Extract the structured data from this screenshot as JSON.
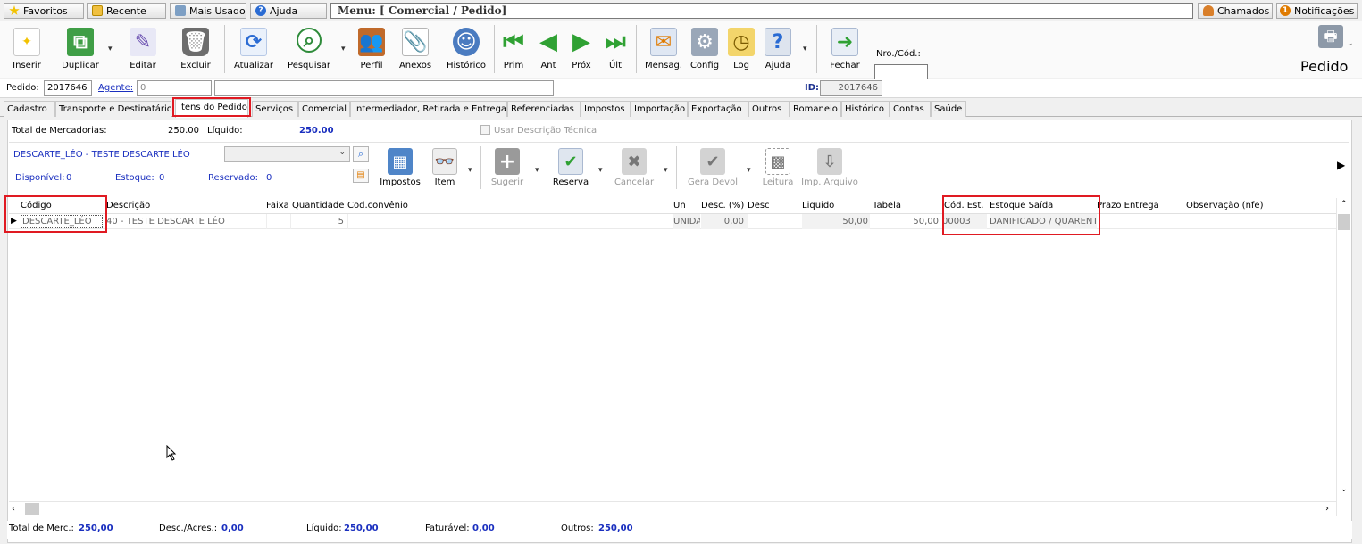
{
  "topbar": {
    "favoritos": "Favoritos",
    "recente": "Recente",
    "mais_usados": "Mais Usados",
    "ajuda": "Ajuda",
    "menu_path": "Menu: [ Comercial / Pedido]",
    "chamados": "Chamados",
    "notificacoes": "Notificações",
    "notif_count": "1"
  },
  "toolbar": {
    "buttons": [
      {
        "label": "Inserir",
        "icon": "new-document-icon"
      },
      {
        "label": "Duplicar",
        "icon": "duplicate-icon"
      },
      {
        "label": "Editar",
        "icon": "edit-pencil-icon"
      },
      {
        "label": "Excluir",
        "icon": "trash-icon"
      },
      {
        "label": "Atualizar",
        "icon": "refresh-icon"
      },
      {
        "label": "Pesquisar",
        "icon": "search-icon"
      },
      {
        "label": "Perfil",
        "icon": "users-icon"
      },
      {
        "label": "Anexos",
        "icon": "attachment-icon"
      },
      {
        "label": "Histórico",
        "icon": "history-icon"
      },
      {
        "label": "Prim",
        "icon": "first-arrow-icon"
      },
      {
        "label": "Ant",
        "icon": "prev-arrow-icon"
      },
      {
        "label": "Próx",
        "icon": "next-arrow-icon"
      },
      {
        "label": "Últ",
        "icon": "last-arrow-icon"
      },
      {
        "label": "Mensag.",
        "icon": "messages-icon"
      },
      {
        "label": "Config",
        "icon": "config-icon"
      },
      {
        "label": "Log",
        "icon": "log-icon"
      },
      {
        "label": "Ajuda",
        "icon": "help-doc-icon"
      },
      {
        "label": "Fechar",
        "icon": "exit-door-icon"
      }
    ],
    "nro_label": "Nro./Cód.:",
    "nro_value": "",
    "module_title": "Pedido"
  },
  "pedido_line": {
    "pedido_label": "Pedido:",
    "pedido_value": "2017646",
    "agente_label": "Agente:",
    "agente_value": "0",
    "id_label": "ID:",
    "id_value": "2017646"
  },
  "tabs": [
    "Cadastro",
    "Transporte e Destinatário",
    "Itens do Pedido",
    "Serviços",
    "Comercial",
    "Intermediador, Retirada e Entrega",
    "Referenciadas",
    "Impostos",
    "Importação",
    "Exportação",
    "Outros",
    "Romaneio",
    "Histórico",
    "Contas",
    "Saúde"
  ],
  "active_tab": "Itens do Pedido",
  "itens": {
    "total_merc_label": "Total de Mercadorias:",
    "total_merc_value": "250.00",
    "liquido_label": "Líquido:",
    "liquido_value": "250.00",
    "usar_desc_label": "Usar Descrição Técnica",
    "product_name": "DESCARTE_LÉO - TESTE DESCARTE LÉO",
    "disponivel_label": "Disponível:",
    "disponivel_value": "0",
    "estoque_label": "Estoque:",
    "estoque_value": "0",
    "reservado_label": "Reservado:",
    "reservado_value": "0",
    "tools": {
      "impostos": "Impostos",
      "item": "Item",
      "sugerir": "Sugerir",
      "reserva": "Reserva",
      "cancelar": "Cancelar",
      "gera_devol": "Gera Devol",
      "leitura": "Leitura",
      "imp_arquivo": "Imp. Arquivo"
    }
  },
  "grid": {
    "headers": {
      "codigo": "Código",
      "descricao": "Descrição",
      "faixa": "Faixa",
      "quantidade": "Quantidade",
      "cod_convenio": "Cod.convênio",
      "un": "Un",
      "desc_pct": "Desc. (%)",
      "desc": "Desc",
      "liquido": "Liquido",
      "tabela": "Tabela",
      "cod_est": "Cód. Est.",
      "estoque_saida": "Estoque Saída",
      "prazo_entrega": "Prazo Entrega",
      "observacao": "Observação (nfe)"
    },
    "rows": [
      {
        "codigo": "DESCARTE_LÉO",
        "descricao": "40 - TESTE DESCARTE LÉO",
        "faixa": "",
        "quantidade": "5",
        "cod_convenio": "",
        "un": "UNIDA",
        "desc_pct": "0,00",
        "desc": "",
        "liquido": "50,00",
        "tabela": "50,00",
        "cod_est": "00003",
        "estoque_saida": "DANIFICADO / QUARENT",
        "prazo_entrega": "",
        "observacao": ""
      }
    ]
  },
  "footer": {
    "total_merc_label": "Total de Merc.:",
    "total_merc_value": "250,00",
    "desc_acres_label": "Desc./Acres.:",
    "desc_acres_value": "0,00",
    "liquido_label": "Líquido:",
    "liquido_value": "250,00",
    "faturavel_label": "Faturável:",
    "faturavel_value": "0,00",
    "outros_label": "Outros:",
    "outros_value": "250,00"
  }
}
